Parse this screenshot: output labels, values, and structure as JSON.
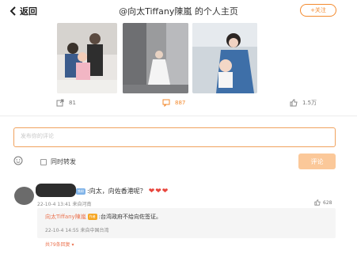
{
  "header": {
    "back_label": "返回",
    "title": "@向太Tiffany陳嵐 的个人主页",
    "follow_label": "+关注"
  },
  "stats": {
    "shares": "81",
    "comments": "887",
    "likes": "1.5万"
  },
  "comment_box": {
    "placeholder": "发布你的评论"
  },
  "actions": {
    "repost_label": "同时转发",
    "submit_label": "评论"
  },
  "comment": {
    "badge": "铁粉",
    "text": ":向太，向佐香港呢？",
    "hearts": "❤❤❤",
    "meta": "22-10-4 13:41 来自河南",
    "likes": "628"
  },
  "reply": {
    "author": "向太Tiffany陳嵐",
    "badge": "作者",
    "text": ":台湾政府不给向佐签证。",
    "meta": "22-10-4 14:55 来自中国台湾",
    "more": "共79条回复 ▾"
  },
  "colors": {
    "accent": "#f38a2e",
    "submit": "#fbc899",
    "link": "#eb7350"
  }
}
